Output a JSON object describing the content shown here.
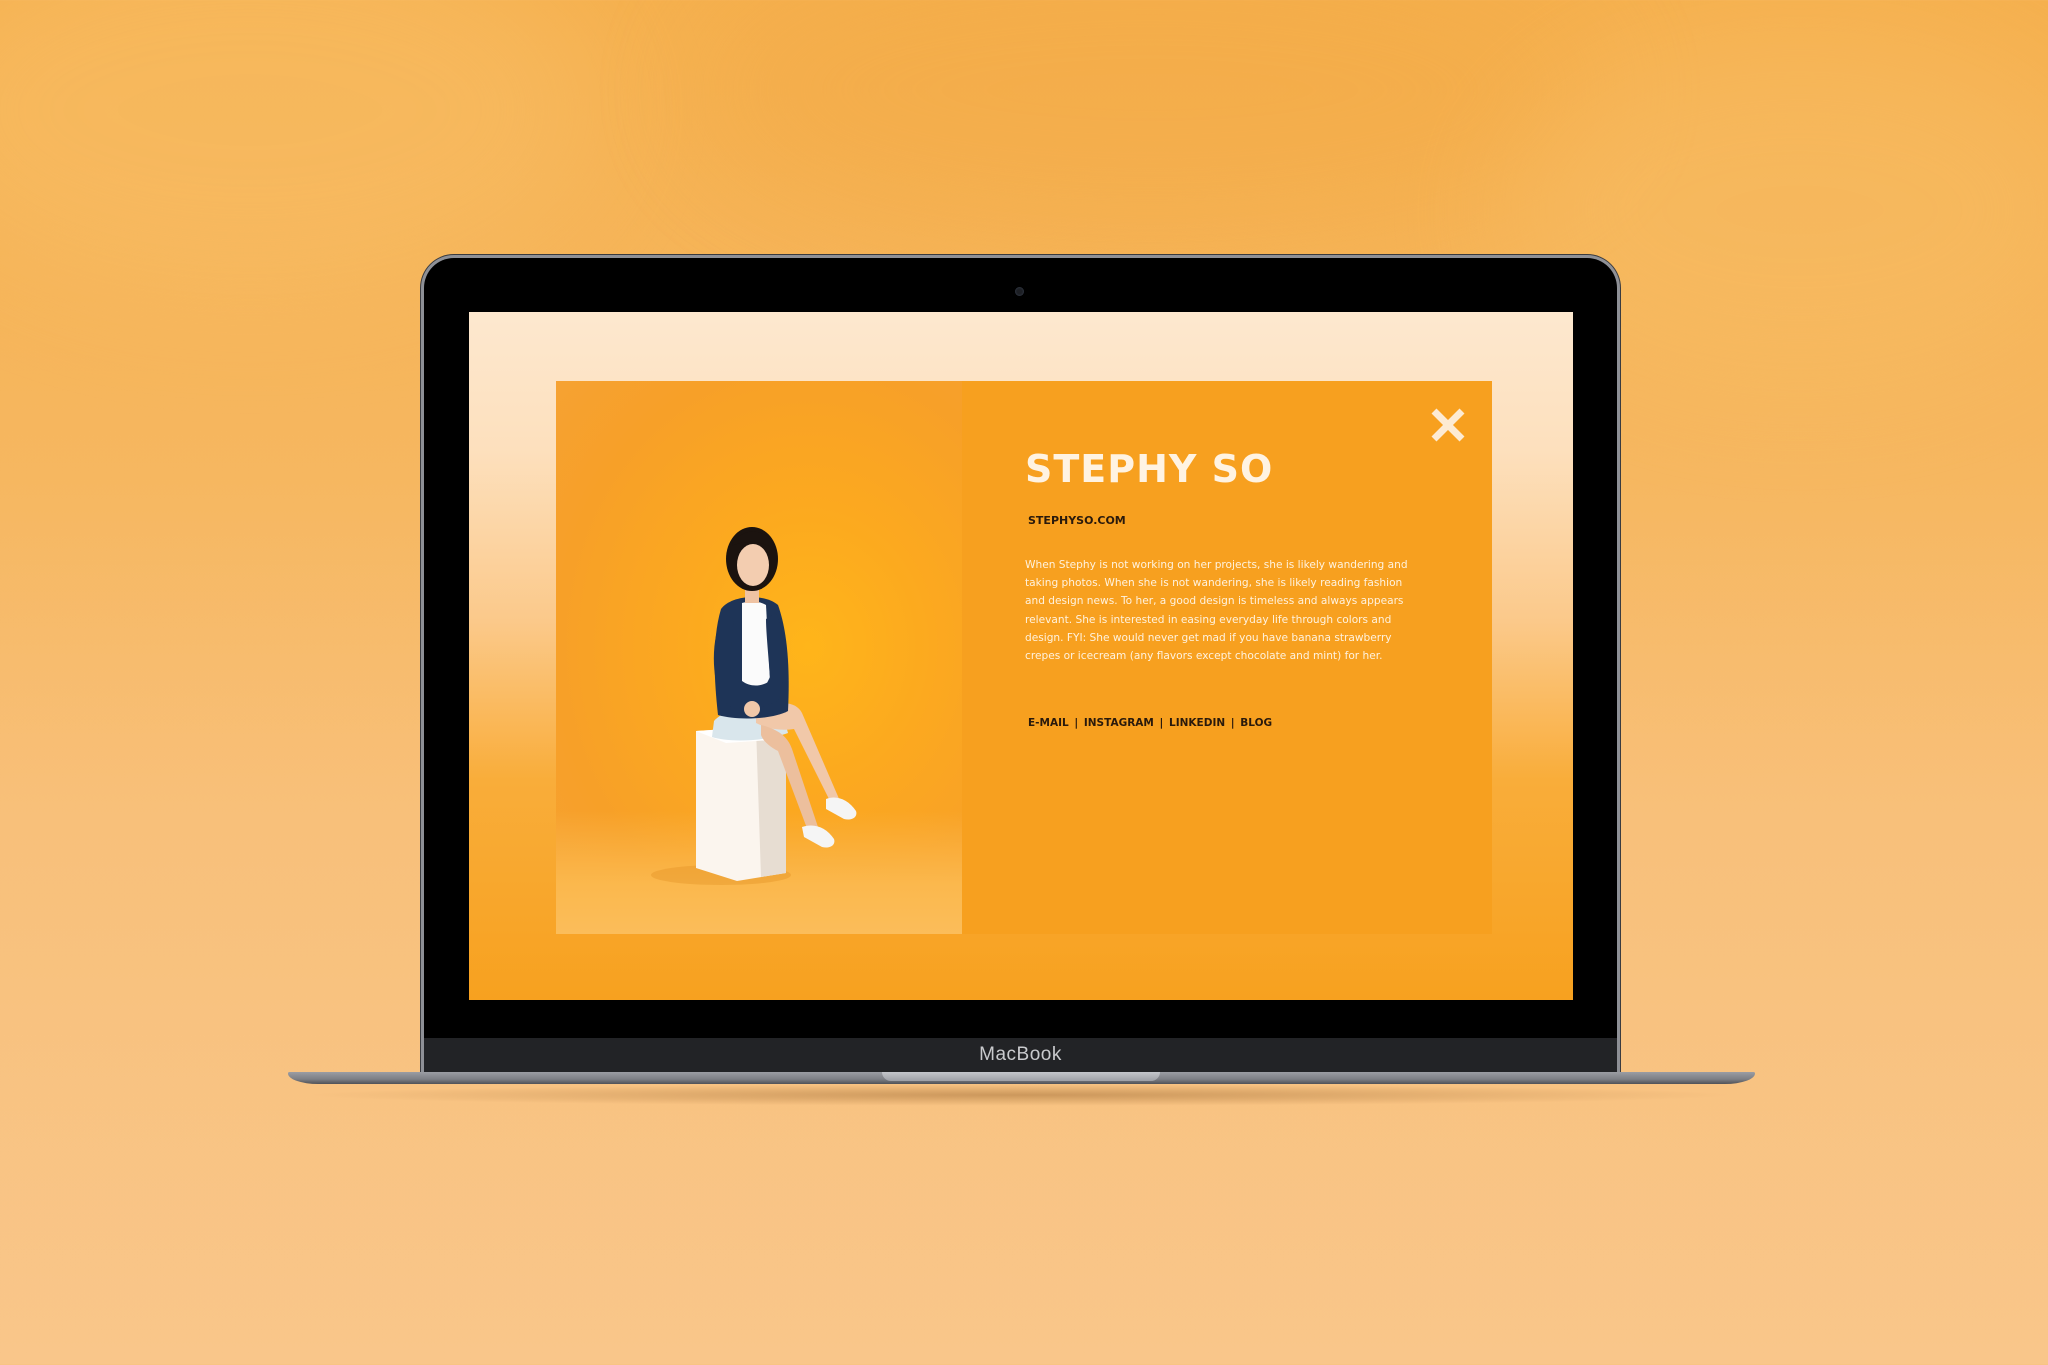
{
  "device": {
    "brand_label": "MacBook"
  },
  "profile": {
    "name": "STEPHY SO",
    "website": "STEPHYSO.COM",
    "bio": "When Stephy is not working on her projects, she is likely wandering and taking photos. When she is not wandering, she is likely reading fashion and design news. To her, a good design is timeless and always appears relevant. She is interested in easing everyday life through colors and design. FYI: She would never get mad if you have banana strawberry crepes or icecream (any flavors except chocolate and mint) for her.",
    "links": [
      {
        "label": "E-MAIL"
      },
      {
        "label": "INSTAGRAM"
      },
      {
        "label": "LINKEDIN"
      },
      {
        "label": "BLOG"
      }
    ],
    "separator": "|"
  },
  "icons": {
    "close": "close-icon"
  },
  "colors": {
    "panel": "#f7a01f",
    "title": "#fff3e2",
    "link_text": "#2a1a0c",
    "close_icon": "#fdebd3"
  }
}
